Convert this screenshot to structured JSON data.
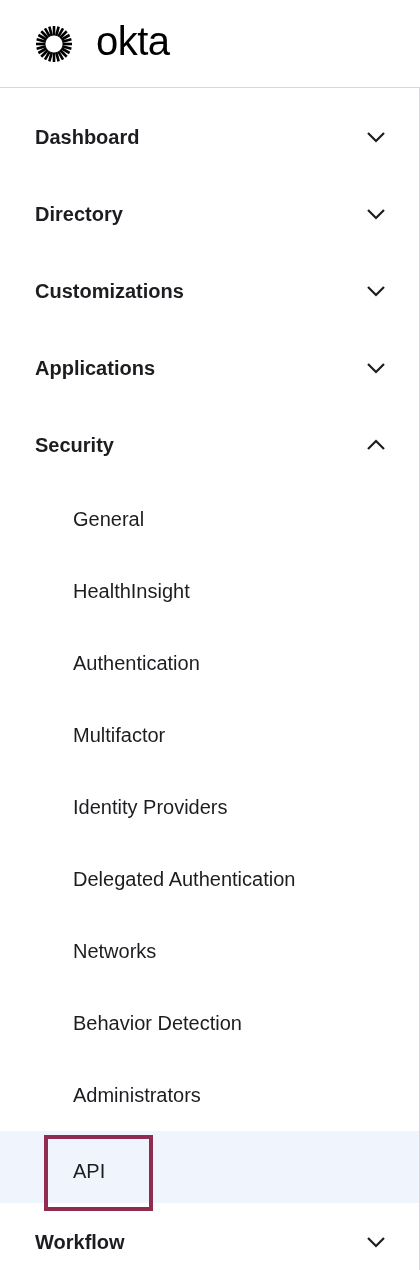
{
  "logo": {
    "text": "okta"
  },
  "nav": [
    {
      "label": "Dashboard",
      "expanded": false
    },
    {
      "label": "Directory",
      "expanded": false
    },
    {
      "label": "Customizations",
      "expanded": false
    },
    {
      "label": "Applications",
      "expanded": false
    },
    {
      "label": "Security",
      "expanded": true,
      "children": [
        {
          "label": "General",
          "selected": false
        },
        {
          "label": "HealthInsight",
          "selected": false
        },
        {
          "label": "Authentication",
          "selected": false
        },
        {
          "label": "Multifactor",
          "selected": false
        },
        {
          "label": "Identity Providers",
          "selected": false
        },
        {
          "label": "Delegated Authentication",
          "selected": false
        },
        {
          "label": "Networks",
          "selected": false
        },
        {
          "label": "Behavior Detection",
          "selected": false
        },
        {
          "label": "Administrators",
          "selected": false
        },
        {
          "label": "API",
          "selected": true
        }
      ]
    },
    {
      "label": "Workflow",
      "expanded": false
    }
  ]
}
